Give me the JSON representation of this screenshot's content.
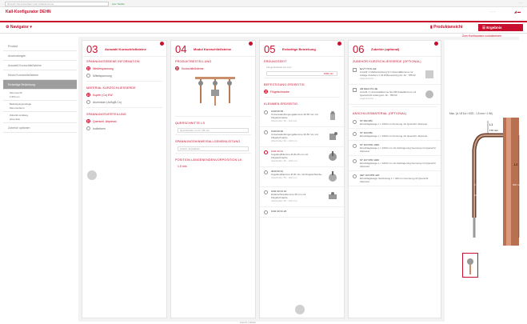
{
  "topstrip": {
    "search_placeholder": "Wonach Sie Ausschau? oder Artikelnummer",
    "search_button": "Los / Suche"
  },
  "brand": {
    "title": "Kall-Konfigurator DEHN"
  },
  "navbar": {
    "navigator_label": "Navigator",
    "product_view_label": "Produktansicht",
    "results_label": "Ergebnis",
    "sub_link": "Zum Konfigurator zurückkehren"
  },
  "sidebar": {
    "items": [
      {
        "label": "Produkt"
      },
      {
        "label": "Anwendungen"
      },
      {
        "label": "Auswahl Kurzschließsteine"
      },
      {
        "label": "Modul Kurzschließsteine"
      },
      {
        "label": "Erdseitige Beiziehung"
      }
    ],
    "sub1": [
      "Klemmen B",
      "1.5/5 mm"
    ],
    "sub2": [
      "Befestigungsvorlage",
      "Klemmenform"
    ],
    "sub3": [
      "Zubehör-Anklang",
      "ohne Zub."
    ],
    "last_item": "Zubehör optionen"
  },
  "columns": [
    {
      "num": "03",
      "title": "Auswahl Kurzschließsteine",
      "sections": [
        {
          "heading": "SPANNUNGSEBENE INFORMATION",
          "options": [
            {
              "label": "Niederspannung",
              "selected": true
            },
            {
              "label": "Mittelspannung",
              "selected": false
            }
          ]
        },
        {
          "heading": "MATERIAL KURZSCHLIESSERDE",
          "options": [
            {
              "label": "Kupfer (Cu) EW",
              "selected": true
            },
            {
              "label": "Aluminium (Al/AgB-Cu)",
              "selected": false
            }
          ]
        },
        {
          "heading": "SPANNUNGSVERTEILUNG",
          "options": [
            {
              "label": "Querschl. Abpresst",
              "selected": true
            },
            {
              "label": "Isolierkern",
              "selected": false
            }
          ]
        }
      ]
    },
    {
      "num": "04",
      "title": "Modul Kurzschließsteine",
      "sections": [
        {
          "heading": "PRODUKTBESTELLUNG",
          "options": [
            {
              "label": "Kurzschließsteine",
              "selected": true
            }
          ]
        }
      ],
      "extra": [
        {
          "heading": "QUERSCHNITTE LS",
          "field": "Querschnitte / mm² / 95 mm"
        },
        {
          "heading": "SPANNUNGSHINWEISALLGEMEINLEITUNG",
          "field": "Anschl. auswählen"
        },
        {
          "heading": "POSITION LÄNGENENDENVORPOSITION LK",
          "value": "1.5 mm"
        }
      ]
    },
    {
      "num": "05",
      "title": "Erdseitige Beiziehung",
      "sections": [
        {
          "heading": "ERDUNGSSEIT",
          "note": "Länge Erdseite bis max.",
          "field_value": "1000 mm"
        },
        {
          "heading": "BEFESTIGUNG ERDSEITIG",
          "options": [
            {
              "label": "Flügelschraube",
              "selected": true
            }
          ]
        },
        {
          "heading": "KLEMMEN ERDSEITIG",
          "options": []
        }
      ],
      "items": [
        {
          "code": "1040 00 95",
          "desc": "Universalanbringungsklemme 30-50 mm mit Flügelschraube",
          "sub": "Abschnitte: 60 - 110 mm",
          "selected": false
        },
        {
          "code": "1040 00 96",
          "desc": "Universalanbringungsklemme 30-50 mm mit Flügelschraube",
          "sub": "Abschnitte: 60 - 120 mm",
          "selected": false
        },
        {
          "code": "1041 00 91",
          "desc": "Kugelkopfklemme Ø 20-25 mm mit Flügelschraube",
          "sub": "Abschnitte: 50 - 100 mm",
          "selected": true
        },
        {
          "code": "3010 00 91",
          "desc": "Kugelkopfklemme Ø 30 mm mit Flügelschraube",
          "sub": "Abschnitte: 50 - 100 mm",
          "selected": false
        },
        {
          "code": "1041 00 91 10",
          "desc": "Erdanschlussklemme 35 mm mit Flügelschraube",
          "sub": "Abschnitte: 50 - 100 mm",
          "selected": false
        },
        {
          "code": "1041 00 91 20",
          "desc": "",
          "sub": "",
          "selected": false
        }
      ]
    },
    {
      "num": "06",
      "title": "Zubehör (optional)",
      "sections": [
        {
          "heading": "ZUBEHÖR KURZSCHLIESSERDE (OPTIONAL)"
        },
        {
          "heading": "ANSCHLUSSMATERIAL (OPTIONAL)"
        }
      ],
      "items_a": [
        {
          "code": "ELVT 70 KL EZ",
          "desc": "Anzahl: 1 Meßanordnung 2x Universalklemme zur Anlage zwischen 7-43 Ø Bemerkung Art.-Nr.: 785 02",
          "sub": "Lagerzeit bis ..."
        },
        {
          "code": "AB FELD PG 4E",
          "desc": "Anzahl: 1 Universalklemme Set AB Kabelklemme mit Querschnitt Anfang Art.-Nr.: 785 03",
          "sub": "Lagerzeit bis ..."
        }
      ],
      "items_b": [
        {
          "code": "ST 002 MM",
          "desc": "Einschlagstange L = 1000 mm Kennung mit Querschl. Abpresst"
        },
        {
          "code": "ST 103 MM",
          "desc": "Einschlagstange L = 1000 mm Kennung mit Querschl. Abpresst"
        },
        {
          "code": "ST 103 FPR 1000",
          "desc": "Einschlagstange L = 1000 mm mit Verlängerung Kennung mit Querschl. Abpresst"
        },
        {
          "code": "ST 107 FPR 1000",
          "desc": "Einschlagstange L = 1000 mm mit Verlängerung Kennung mit Querschl. Abpresst"
        },
        {
          "code": "SET 103 FPR 420",
          "desc": "Einschlagstange Verbindung L = 420 mm Kennung mit Querschl. Abpresst"
        }
      ]
    }
  ],
  "product_view": {
    "dim_label": "Max. (A / Ø 8 a / KSS - 1,5 mm / 1 Wi)",
    "lbl_l1": "L1",
    "val_l1": "170 mm",
    "lbl_l2": "L2",
    "val_l2": "2 500 mm",
    "val_1000": "1000 mm",
    "val_right": "300 mm"
  },
  "bottom": {
    "pager": "Zurück  |  Weiter"
  },
  "colors": {
    "accent": "#c8102e",
    "panel_bg": "#f3f3f3",
    "sidebar_active": "#9d9d9d"
  }
}
